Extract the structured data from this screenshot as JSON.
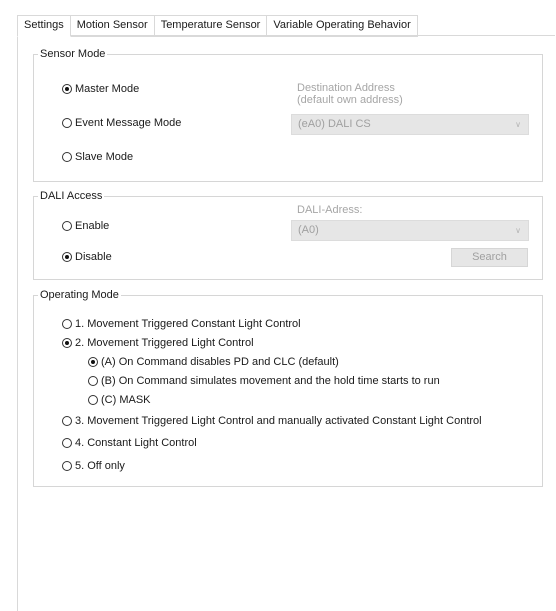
{
  "tabs": [
    "Settings",
    "Motion Sensor",
    "Temperature Sensor",
    "Variable Operating Behavior"
  ],
  "sensor_mode": {
    "title": "Sensor Mode",
    "options": [
      {
        "label": "Master Mode",
        "selected": true
      },
      {
        "label": "Event Message Mode",
        "selected": false
      },
      {
        "label": "Slave Mode",
        "selected": false
      }
    ],
    "destination_label_line1": "Destination Address",
    "destination_label_line2": "(default own address)",
    "destination_value": "(eA0) DALI CS"
  },
  "dali_access": {
    "title": "DALI Access",
    "options": [
      {
        "label": "Enable",
        "selected": false
      },
      {
        "label": "Disable",
        "selected": true
      }
    ],
    "address_label": "DALI-Adress:",
    "address_value": "(A0)",
    "search_label": "Search"
  },
  "operating_mode": {
    "title": "Operating Mode",
    "options": [
      {
        "label": "1. Movement Triggered Constant Light Control",
        "selected": false
      },
      {
        "label": "2. Movement Triggered Light Control",
        "selected": true
      },
      {
        "label": "3. Movement Triggered Light Control and manually activated Constant Light Control",
        "selected": false
      },
      {
        "label": "4. Constant Light Control",
        "selected": false
      },
      {
        "label": "5. Off only",
        "selected": false
      }
    ],
    "sub_options": [
      {
        "label": "(A) On Command disables PD and CLC (default)",
        "selected": true
      },
      {
        "label": "(B) On Command simulates movement and the hold time starts to run",
        "selected": false
      },
      {
        "label": "(C) MASK",
        "selected": false
      }
    ]
  },
  "icons": {
    "dropdown": "chevron-down-icon",
    "radio": "radio-icon"
  }
}
